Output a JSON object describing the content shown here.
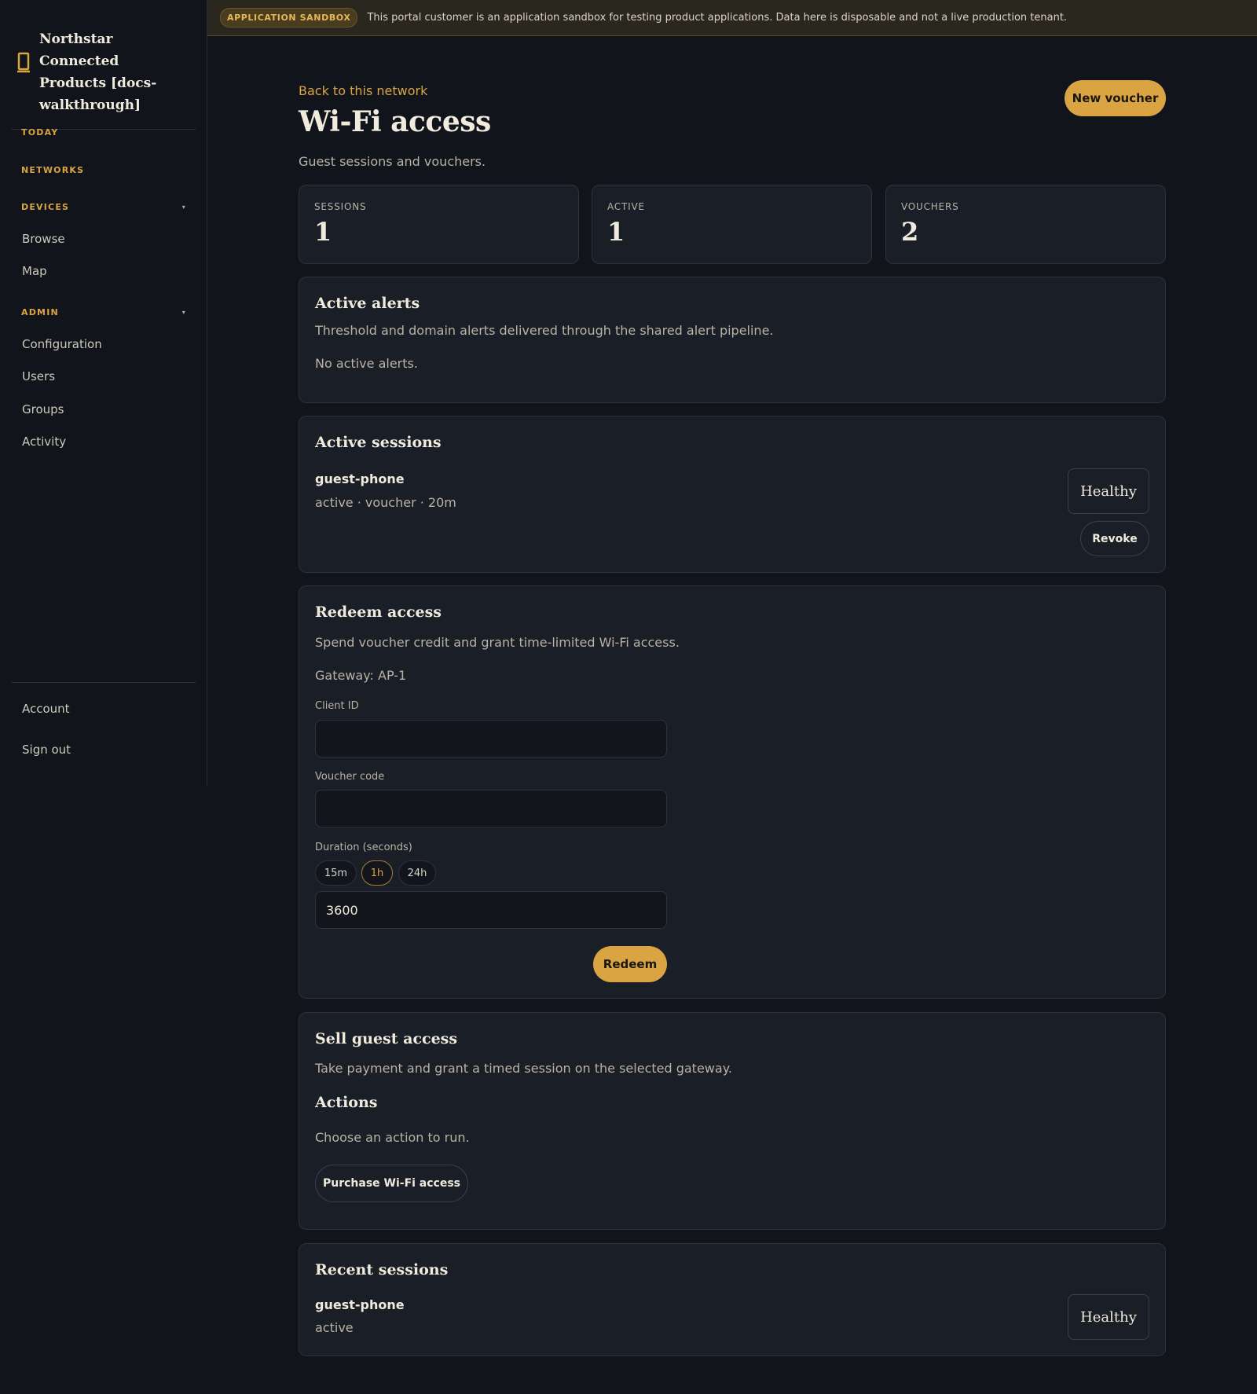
{
  "sidebar": {
    "brand": "Northstar Connected Products [docs-walkthrough]",
    "today": "TODAY",
    "networks": "NETWORKS",
    "devices": {
      "label": "DEVICES",
      "items": [
        "Browse",
        "Map"
      ]
    },
    "admin": {
      "label": "ADMIN",
      "items": [
        "Configuration",
        "Users",
        "Groups",
        "Activity"
      ]
    },
    "footer": [
      "Account",
      "Sign out"
    ],
    "caret": "▾"
  },
  "banner": {
    "badge": "APPLICATION SANDBOX",
    "text": "This portal customer is an application sandbox for testing product applications. Data here is disposable and not a live production tenant."
  },
  "header": {
    "back": "Back to this network",
    "title": "Wi-Fi access",
    "subtitle": "Guest sessions and vouchers.",
    "new_voucher": "New voucher"
  },
  "stats": [
    {
      "label": "SESSIONS",
      "value": "1"
    },
    {
      "label": "ACTIVE",
      "value": "1"
    },
    {
      "label": "VOUCHERS",
      "value": "2"
    }
  ],
  "alerts": {
    "title": "Active alerts",
    "description": "Threshold and domain alerts delivered through the shared alert pipeline.",
    "empty": "No active alerts."
  },
  "active_sessions": {
    "title": "Active sessions",
    "name": "guest-phone",
    "meta": "active · voucher · 20m",
    "status": "Healthy",
    "revoke": "Revoke"
  },
  "redeem": {
    "title": "Redeem access",
    "description": "Spend voucher credit and grant time-limited Wi-Fi access.",
    "gateway": "Gateway: AP-1",
    "client_label": "Client ID",
    "client_value": "",
    "voucher_label": "Voucher code",
    "voucher_value": "",
    "duration_label": "Duration (seconds)",
    "chips": [
      "15m",
      "1h",
      "24h"
    ],
    "selected_chip": "1h",
    "duration_value": "3600",
    "submit": "Redeem"
  },
  "sell": {
    "title": "Sell guest access",
    "description": "Take payment and grant a timed session on the selected gateway.",
    "actions_title": "Actions",
    "actions_text": "Choose an action to run.",
    "purchase": "Purchase Wi-Fi access"
  },
  "recent": {
    "title": "Recent sessions",
    "name": "guest-phone",
    "meta": "active",
    "status": "Healthy"
  },
  "colors": {
    "accent": "#d9a441",
    "background": "#11151b",
    "card": "#1a1f27"
  }
}
